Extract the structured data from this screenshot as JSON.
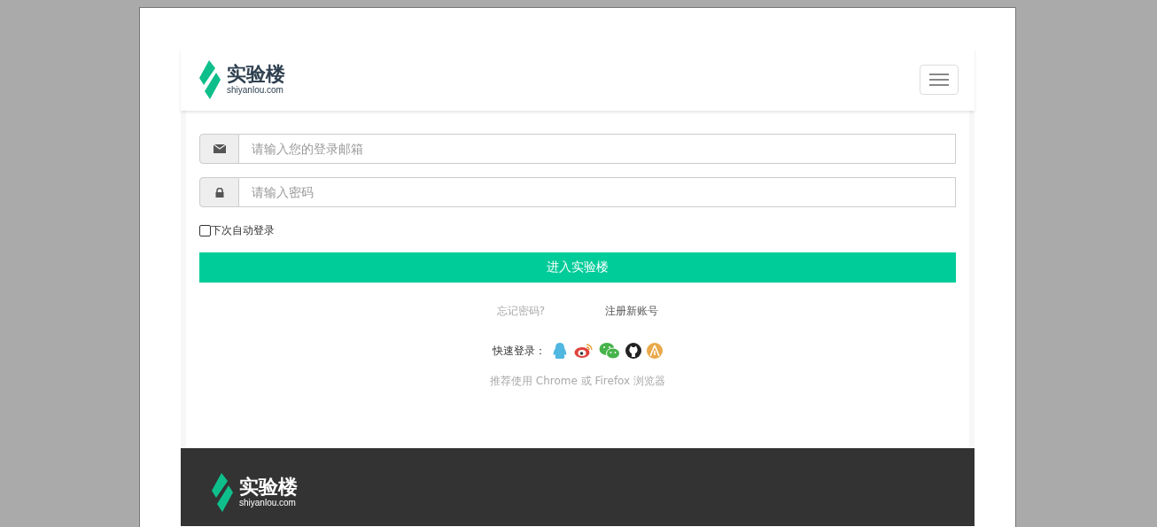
{
  "header": {
    "logo": {
      "name": "实验楼",
      "domain": "shiyanlou.com"
    }
  },
  "form": {
    "email": {
      "placeholder": "请输入您的登录邮箱"
    },
    "password": {
      "placeholder": "请输入密码"
    },
    "remember": {
      "label": "下次自动登录",
      "checked": false
    },
    "submit": "进入实验楼",
    "links": [
      {
        "label": "忘记密码?",
        "kind": "muted"
      },
      {
        "label": "注册新账号",
        "kind": "strong"
      }
    ],
    "quick_login": {
      "label": "快速登录：",
      "providers": [
        {
          "kind": "qq"
        },
        {
          "kind": "weibo"
        },
        {
          "kind": "wechat"
        },
        {
          "kind": "github"
        },
        {
          "kind": "other"
        }
      ]
    },
    "note": "推荐使用 Chrome 或 Firefox 浏览器"
  },
  "footer": {
    "logo": {
      "name": "实验楼",
      "domain": "shiyanlou.com"
    }
  }
}
